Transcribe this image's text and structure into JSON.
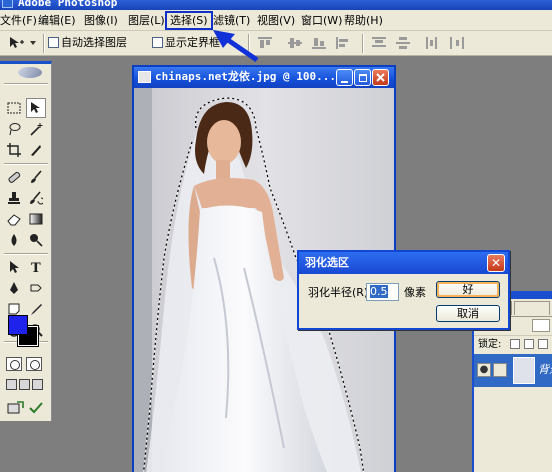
{
  "app": {
    "title": "Adobe Photoshop"
  },
  "menu": {
    "items": [
      "文件(F)",
      "编辑(E)",
      "图像(I)",
      "图层(L)",
      "选择(S)",
      "滤镜(T)",
      "视图(V)",
      "窗口(W)",
      "帮助(H)"
    ],
    "selected_index": 4
  },
  "options": {
    "auto_select_label": "自动选择图层",
    "show_bounds_label": "显示定界框"
  },
  "document": {
    "title": "chinaps.net龙依.jpg @ 100..."
  },
  "dialog": {
    "title": "羽化选区",
    "close_glyph": "✕",
    "radius_label": "羽化半径(R):",
    "radius_value": "0.5",
    "unit": "像素",
    "ok_label": "好",
    "cancel_label": "取消"
  },
  "layers_panel": {
    "tab_channels": "通道",
    "lock_label": "锁定:",
    "layer_name": "背景"
  },
  "colors": {
    "foreground": "#1e22ea",
    "background": "#000000",
    "accent": "#1030c8",
    "selection_arrow": "#1030d8"
  },
  "icons": {
    "toolbox": [
      "marquee-icon",
      "move-icon",
      "lasso-icon",
      "magic-wand-icon",
      "crop-icon",
      "slice-icon",
      "healing-brush-icon",
      "brush-icon",
      "clone-stamp-icon",
      "history-brush-icon",
      "eraser-icon",
      "gradient-icon",
      "blur-icon",
      "dodge-icon",
      "path-select-icon",
      "type-icon",
      "pen-icon",
      "shape-icon",
      "notes-icon",
      "eyedropper-icon",
      "hand-icon",
      "zoom-icon"
    ]
  }
}
